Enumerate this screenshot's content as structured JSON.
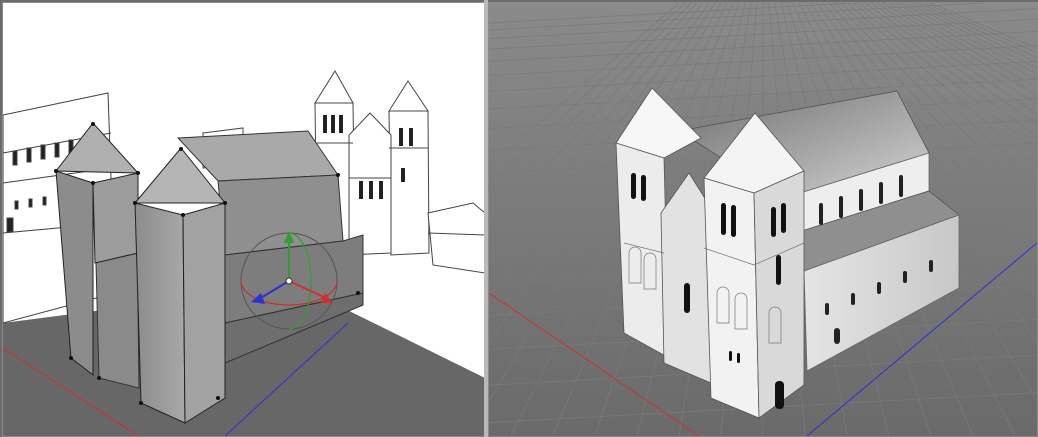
{
  "viewports": {
    "left": {
      "mode": "sketch",
      "selection": "gizmo"
    },
    "right": {
      "mode": "render"
    }
  },
  "colors": {
    "x_axis": "#d03030",
    "y_axis": "#2fa02f",
    "z_axis": "#3030d0",
    "ground_left": "#666666",
    "ground_right": "#8e8e8e",
    "model_gray": "#9a9a9a",
    "model_white": "#f2f2f2"
  },
  "icons": [
    "move-gizmo-icon"
  ]
}
